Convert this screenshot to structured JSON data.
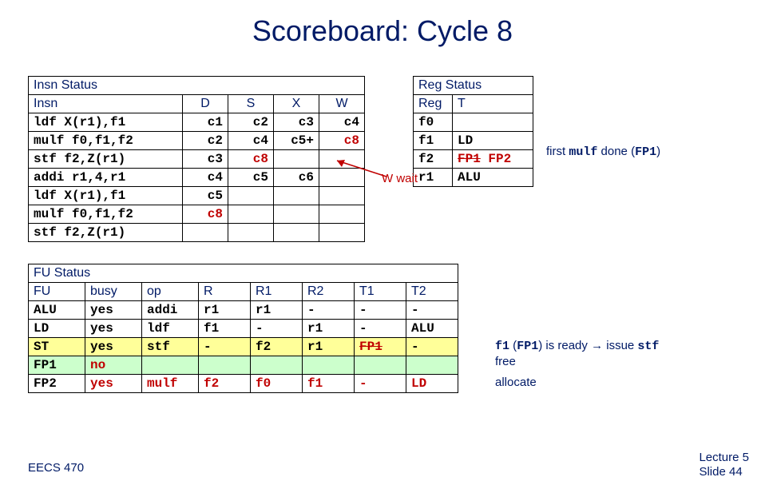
{
  "title": "Scoreboard: Cycle 8",
  "insn": {
    "header": "Insn Status",
    "cols": [
      "Insn",
      "D",
      "S",
      "X",
      "W"
    ],
    "rows": [
      {
        "i": "ldf X(r1),f1",
        "d": "c1",
        "s": "c2",
        "x": "c3",
        "w": "c4"
      },
      {
        "i": "mulf f0,f1,f2",
        "d": "c2",
        "s": "c4",
        "x": "c5+",
        "w": "c8"
      },
      {
        "i": "stf f2,Z(r1)",
        "d": "c3",
        "s": "c8",
        "x": "",
        "w": ""
      },
      {
        "i": "addi r1,4,r1",
        "d": "c4",
        "s": "c5",
        "x": "c6",
        "w": ""
      },
      {
        "i": "ldf X(r1),f1",
        "d": "c5",
        "s": "",
        "x": "",
        "w": ""
      },
      {
        "i": "mulf f0,f1,f2",
        "d": "c8",
        "s": "",
        "x": "",
        "w": ""
      },
      {
        "i": "stf f2,Z(r1)",
        "d": "",
        "s": "",
        "x": "",
        "w": ""
      }
    ]
  },
  "reg": {
    "header": "Reg Status",
    "cols": [
      "Reg",
      "T"
    ],
    "rows": [
      {
        "r": "f0",
        "t": ""
      },
      {
        "r": "f1",
        "t": "LD"
      },
      {
        "r": "f2",
        "t_strike": "FP1",
        "t_new": "FP2"
      },
      {
        "r": "r1",
        "t": "ALU"
      }
    ]
  },
  "fu": {
    "header": "FU Status",
    "cols": [
      "FU",
      "busy",
      "op",
      "R",
      "R1",
      "R2",
      "T1",
      "T2"
    ],
    "rows": [
      {
        "fu": "ALU",
        "busy": "yes",
        "op": "addi",
        "r": "r1",
        "r1": "r1",
        "r2": "-",
        "t1": "-",
        "t2": "-"
      },
      {
        "fu": "LD",
        "busy": "yes",
        "op": "ldf",
        "r": "f1",
        "r1": "-",
        "r2": "r1",
        "t1": "-",
        "t2": "ALU"
      },
      {
        "fu": "ST",
        "busy": "yes",
        "op": "stf",
        "r": "-",
        "r1": "f2",
        "r2": "r1",
        "t1": "FP1",
        "t2": "-"
      },
      {
        "fu": "FP1",
        "busy": "no",
        "op": "",
        "r": "",
        "r1": "",
        "r2": "",
        "t1": "",
        "t2": ""
      },
      {
        "fu": "FP2",
        "busy": "yes",
        "op": "mulf",
        "r": "f2",
        "r1": "f0",
        "r2": "f1",
        "t1": "-",
        "t2": "LD"
      }
    ]
  },
  "annot": {
    "wwait": "W wait",
    "first_mulf_a": "first ",
    "first_mulf_b": "mulf",
    "first_mulf_c": " done (",
    "first_mulf_d": "FP1",
    "first_mulf_e": ")",
    "st_a": "f1",
    "st_b": " (",
    "st_c": "FP1",
    "st_d": ") is ready ",
    "st_arrow": "→",
    "st_e": " issue ",
    "st_f": "stf",
    "free": "free",
    "allocate": "allocate"
  },
  "footer": {
    "left": "EECS 470",
    "right1": "Lecture 5",
    "right2": "Slide 44"
  }
}
